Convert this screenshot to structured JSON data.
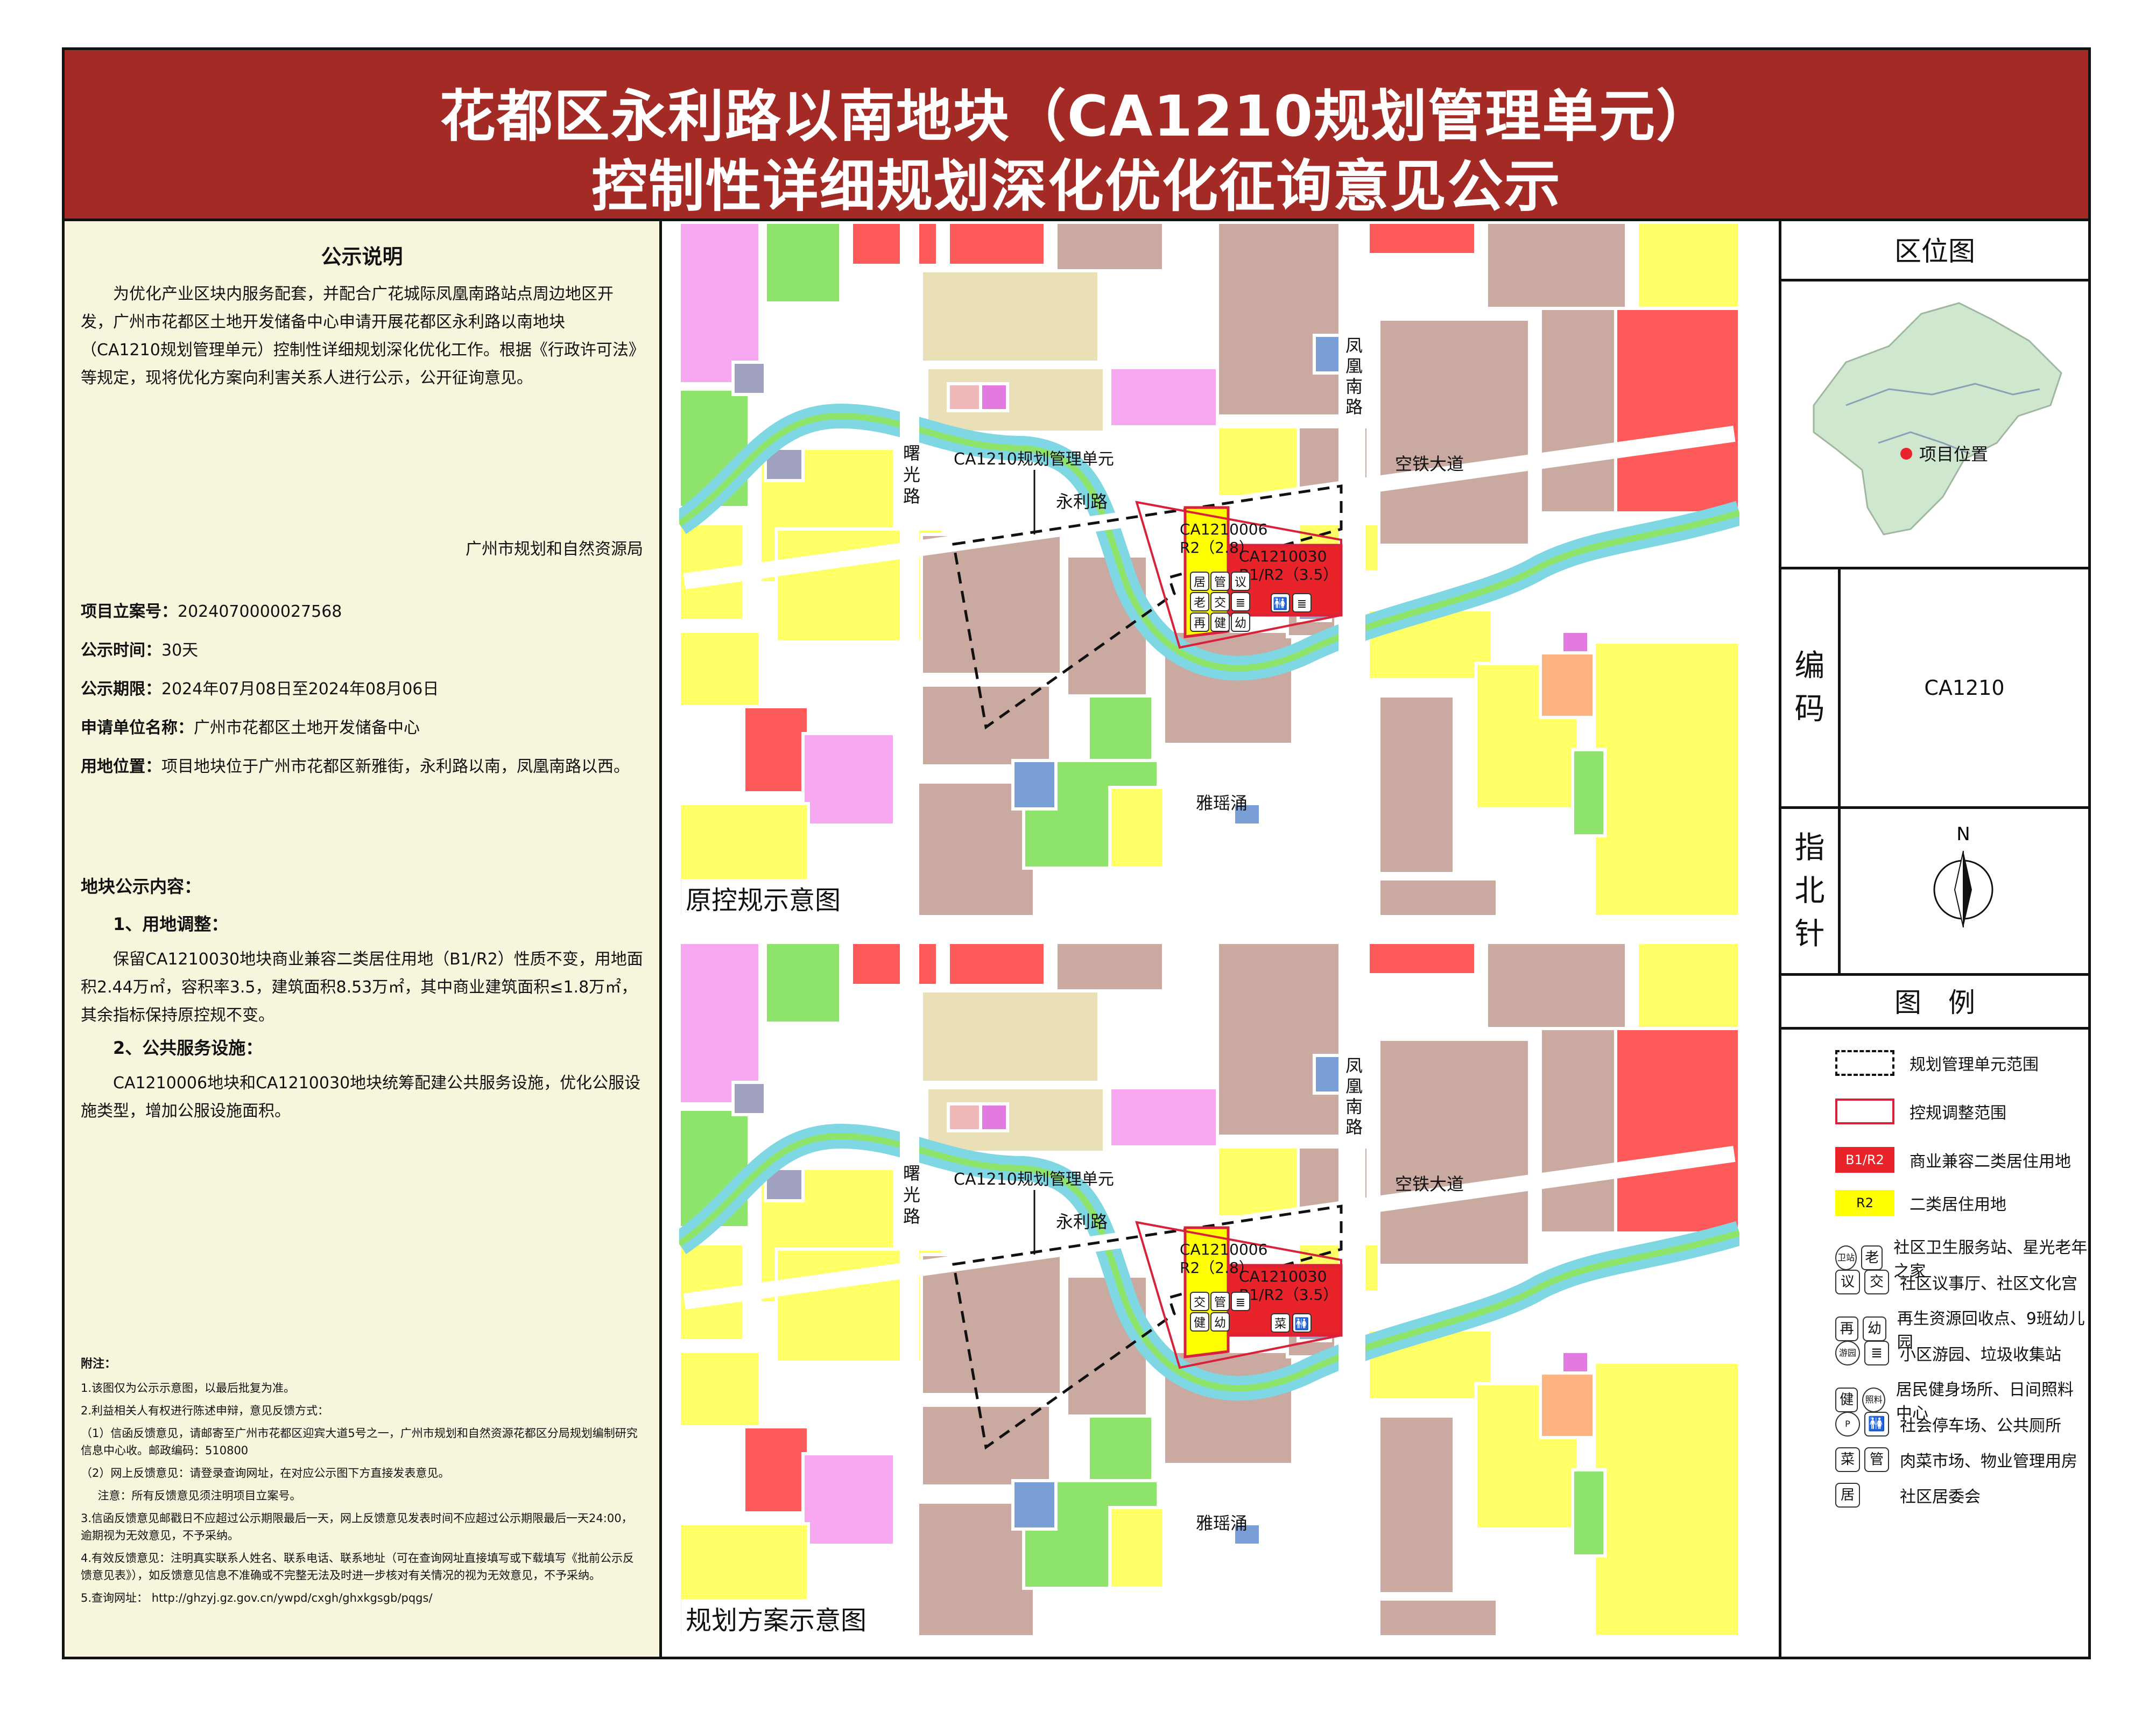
{
  "title": {
    "line1": "花都区永利路以南地块（CA1210规划管理单元）",
    "line2": "控制性详细规划深化优化征询意见公示"
  },
  "left": {
    "heading": "公示说明",
    "intro": "为优化产业区块内服务配套，并配合广花城际凤凰南路站点周边地区开发，广州市花都区土地开发储备中心申请开展花都区永利路以南地块（CA1210规划管理单元）控制性详细规划深化优化工作。根据《行政许可法》等规定，现将优化方案向利害关系人进行公示，公开征询意见。",
    "org": "广州市规划和自然资源局",
    "fields": [
      {
        "label": "项目立案号：",
        "value": "2024070000027568"
      },
      {
        "label": "公示时间：",
        "value": "30天"
      },
      {
        "label": "公示期限：",
        "value": "2024年07月08日至2024年08月06日"
      },
      {
        "label": "申请单位名称：",
        "value": "广州市花都区土地开发储备中心"
      },
      {
        "label": "用地位置：",
        "value": "项目地块位于广州市花都区新雅街，永利路以南，凤凰南路以西。"
      }
    ],
    "content_heading": "地块公示内容：",
    "item1_title": "1、用地调整：",
    "item1_text": "保留CA1210030地块商业兼容二类居住用地（B1/R2）性质不变，用地面积2.44万㎡，容积率3.5，建筑面积8.53万㎡，其中商业建筑面积≤1.8万㎡，其余指标保持原控规不变。",
    "item2_title": "2、公共服务设施：",
    "item2_text": "CA1210006地块和CA1210030地块统筹配建公共服务设施，优化公服设施类型，增加公服设施面积。",
    "notes_title": "附注：",
    "notes": [
      "1.该图仅为公示示意图，以最后批复为准。",
      "2.利益相关人有权进行陈述申辩，意见反馈方式：",
      "（1）信函反馈意见，请邮寄至广州市花都区迎宾大道5号之一，广州市规划和自然资源花都区分局规划编制研究信息中心收。邮政编码：510800",
      "（2）网上反馈意见：请登录查询网址，在对应公示图下方直接发表意见。",
      "注意：所有反馈意见须注明项目立案号。",
      "3.信函反馈意见邮戳日不应超过公示期限最后一天，网上反馈意见发表时间不应超过公示期限最后一天24:00，逾期视为无效意见，不予采纳。",
      "4.有效反馈意见：注明真实联系人姓名、联系电话、联系地址（可在查询网址直接填写或下载填写《批前公示反馈意见表》），如反馈意见信息不准确或不完整无法及时进一步核对有关情况的视为无效意见，不予采纳。",
      "5.查询网址： http://ghzyj.gz.gov.cn/ywpd/cxgh/ghxkgsgb/pqgs/"
    ]
  },
  "maps": {
    "original": {
      "caption": "原控规示意图",
      "unit_label": "CA1210规划管理单元",
      "plot_a_code": "CA1210006",
      "plot_a_use": "R2（2.8）",
      "plot_b_code": "CA1210030",
      "plot_b_use": "B1/R2（3.5）",
      "icons_a": [
        "居",
        "管",
        "议",
        "老",
        "交",
        "≣",
        "再",
        "健",
        "幼"
      ],
      "icons_b": [
        "🚻",
        "≣"
      ]
    },
    "planned": {
      "caption": "规划方案示意图",
      "unit_label": "CA1210规划管理单元",
      "plot_a_code": "CA1210006",
      "plot_a_use": "R2（2.8）",
      "plot_b_code": "CA1210030",
      "plot_b_use": "B1/R2（3.5）",
      "icons_a": [
        "交",
        "管",
        "≣",
        "健",
        "幼"
      ],
      "icons_b": [
        "菜",
        "🚻"
      ]
    },
    "roads": {
      "fenghuang": "凤凰南路",
      "shuguang": "曙光路",
      "yongli": "永利路",
      "kongtie": "空铁大道",
      "yayao": "雅瑶涌"
    }
  },
  "right": {
    "location_title": "区位图",
    "location_marker": "项目位置",
    "code_label": "编码",
    "code_value": "CA1210",
    "north_label": "指北针",
    "north_letter": "N",
    "legend_title": "图　例",
    "legend": [
      {
        "swatch": "",
        "label": "规划管理单元范围"
      },
      {
        "swatch": "",
        "label": "控规调整范围"
      },
      {
        "swatch": "B1/R2",
        "label": "商业兼容二类居住用地"
      },
      {
        "swatch": "R2",
        "label": "二类居住用地"
      },
      {
        "icons": [
          "卫站",
          "老"
        ],
        "label": "社区卫生服务站、星光老年之家"
      },
      {
        "icons": [
          "议",
          "交"
        ],
        "label": "社区议事厅、社区文化宫"
      },
      {
        "icons": [
          "再",
          "幼"
        ],
        "label": "再生资源回收点、9班幼儿园"
      },
      {
        "icons": [
          "游园",
          "≣"
        ],
        "label": "小区游园、垃圾收集站"
      },
      {
        "icons": [
          "健",
          "照料"
        ],
        "label": "居民健身场所、日间照料中心"
      },
      {
        "icons": [
          "P",
          "🚻"
        ],
        "label": "社会停车场、公共厕所"
      },
      {
        "icons": [
          "菜",
          "管"
        ],
        "label": "肉菜市场、物业管理用房"
      },
      {
        "icons": [
          "居"
        ],
        "label": "社区居委会"
      }
    ],
    "colors": {
      "b1r2": "#e8232a",
      "r2": "#ffff00",
      "brown": "#c9a9a0",
      "green": "#8ee36b",
      "water": "#7fd7e3",
      "boundary": "#d9213a"
    }
  }
}
